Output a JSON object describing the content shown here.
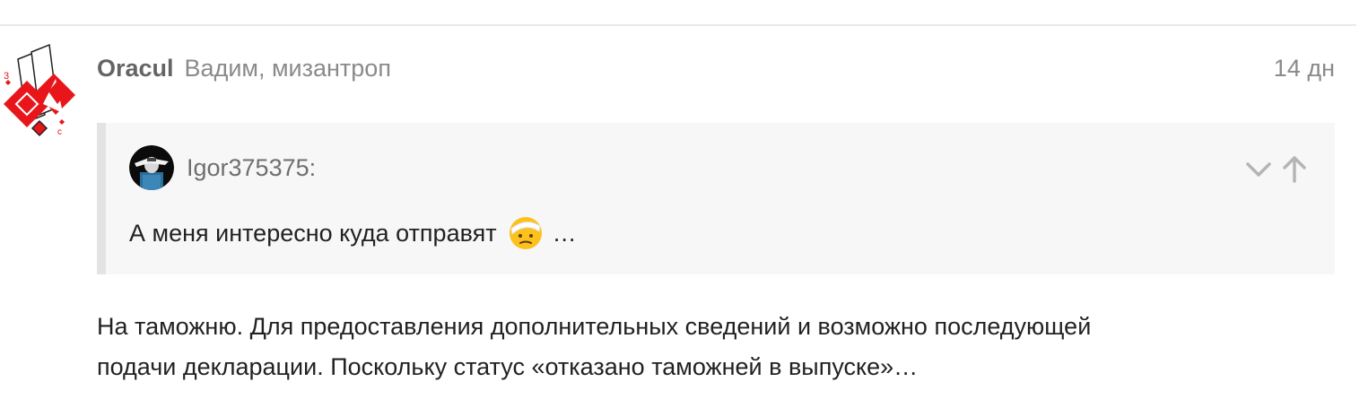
{
  "post": {
    "username": "Oracul",
    "user_title": "Вадим, мизантроп",
    "date": "14 дн",
    "quote": {
      "username": "Igor375375:",
      "text": "А меня интересно куда отправят",
      "emoji_icon": "face-with-head-bandage-icon",
      "ellipsis": "…"
    },
    "body_lines": [
      "На таможню. Для предоставления дополнительных сведений и возможно последующей",
      "подачи декларации. Поскольку статус «отказано таможней в выпуске»…"
    ]
  },
  "colors": {
    "avatar_red": "#e8161b",
    "quote_bg": "#f7f7f7",
    "quote_border": "#e3e3e3"
  }
}
